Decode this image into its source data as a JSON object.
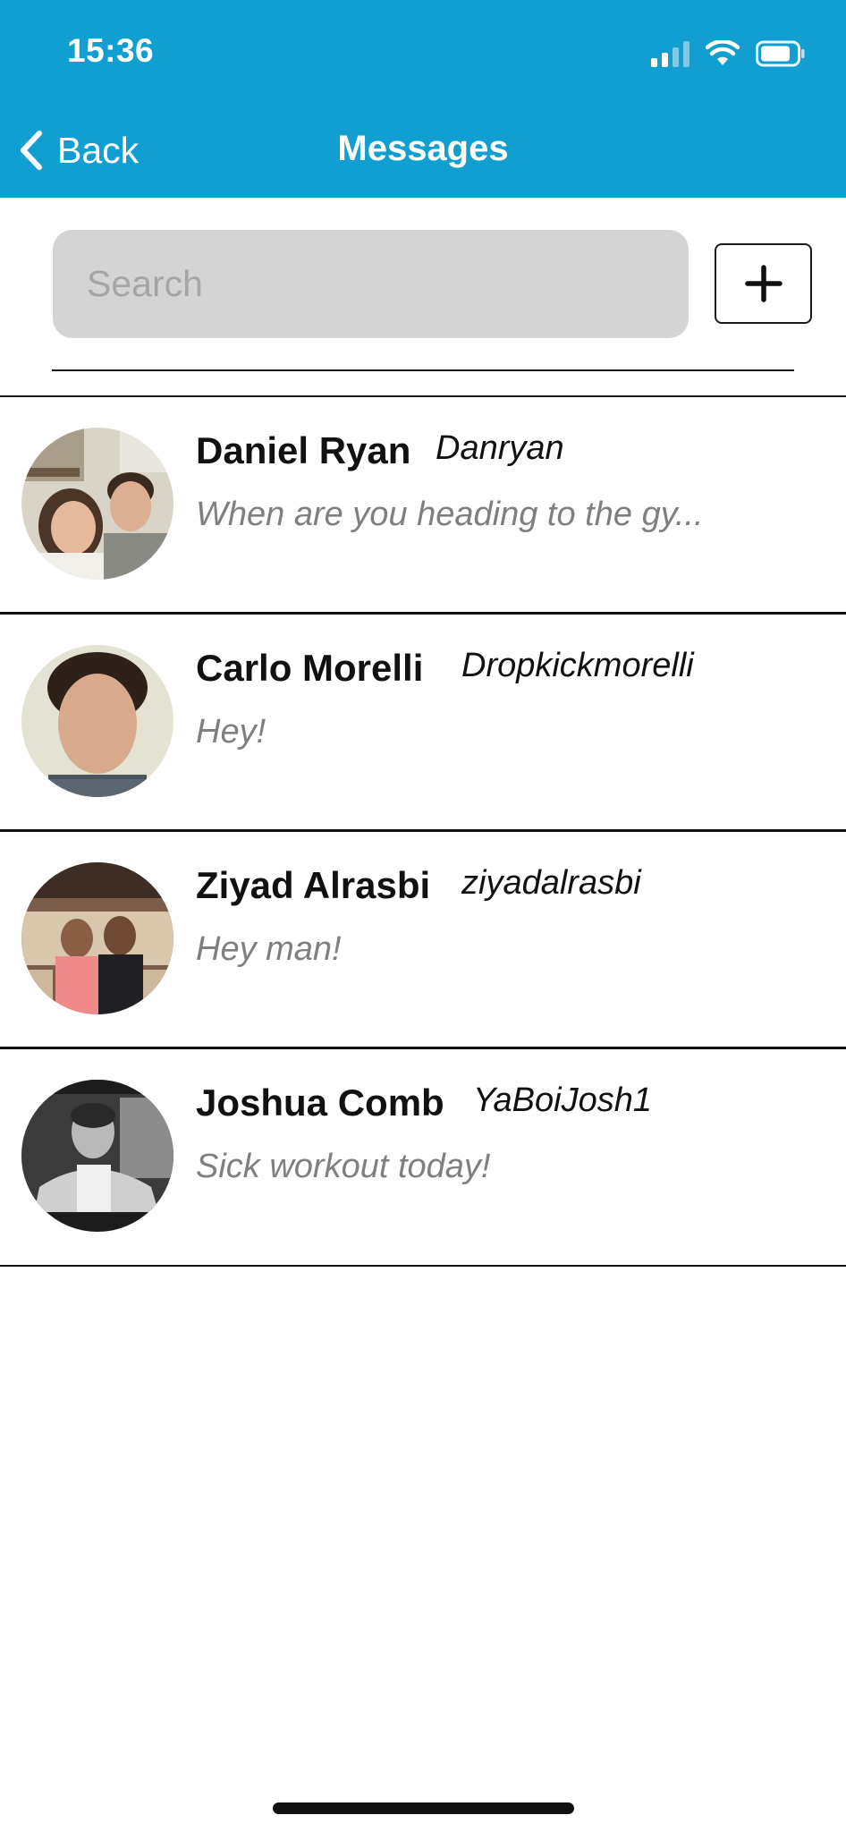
{
  "status_bar": {
    "time": "15:36",
    "icons": [
      "cellular-signal-icon",
      "wifi-icon",
      "battery-icon"
    ]
  },
  "nav": {
    "back_label": "Back",
    "title": "Messages"
  },
  "search": {
    "placeholder": "Search",
    "value": ""
  },
  "add_button": {
    "icon": "plus-icon"
  },
  "colors": {
    "header": "#119fd1",
    "search_field": "#d4d4d4",
    "preview_text": "#7f7f7f"
  },
  "conversations": [
    {
      "name": "Daniel Ryan",
      "username": "Danryan",
      "preview": "When are you heading to the gy..."
    },
    {
      "name": "Carlo Morelli",
      "username": "Dropkickmorelli",
      "preview": "Hey!"
    },
    {
      "name": "Ziyad Alrasbi",
      "username": "ziyadalrasbi",
      "preview": "Hey man!"
    },
    {
      "name": "Joshua Comb",
      "username": "YaBoiJosh1",
      "preview": "Sick workout today!"
    }
  ]
}
